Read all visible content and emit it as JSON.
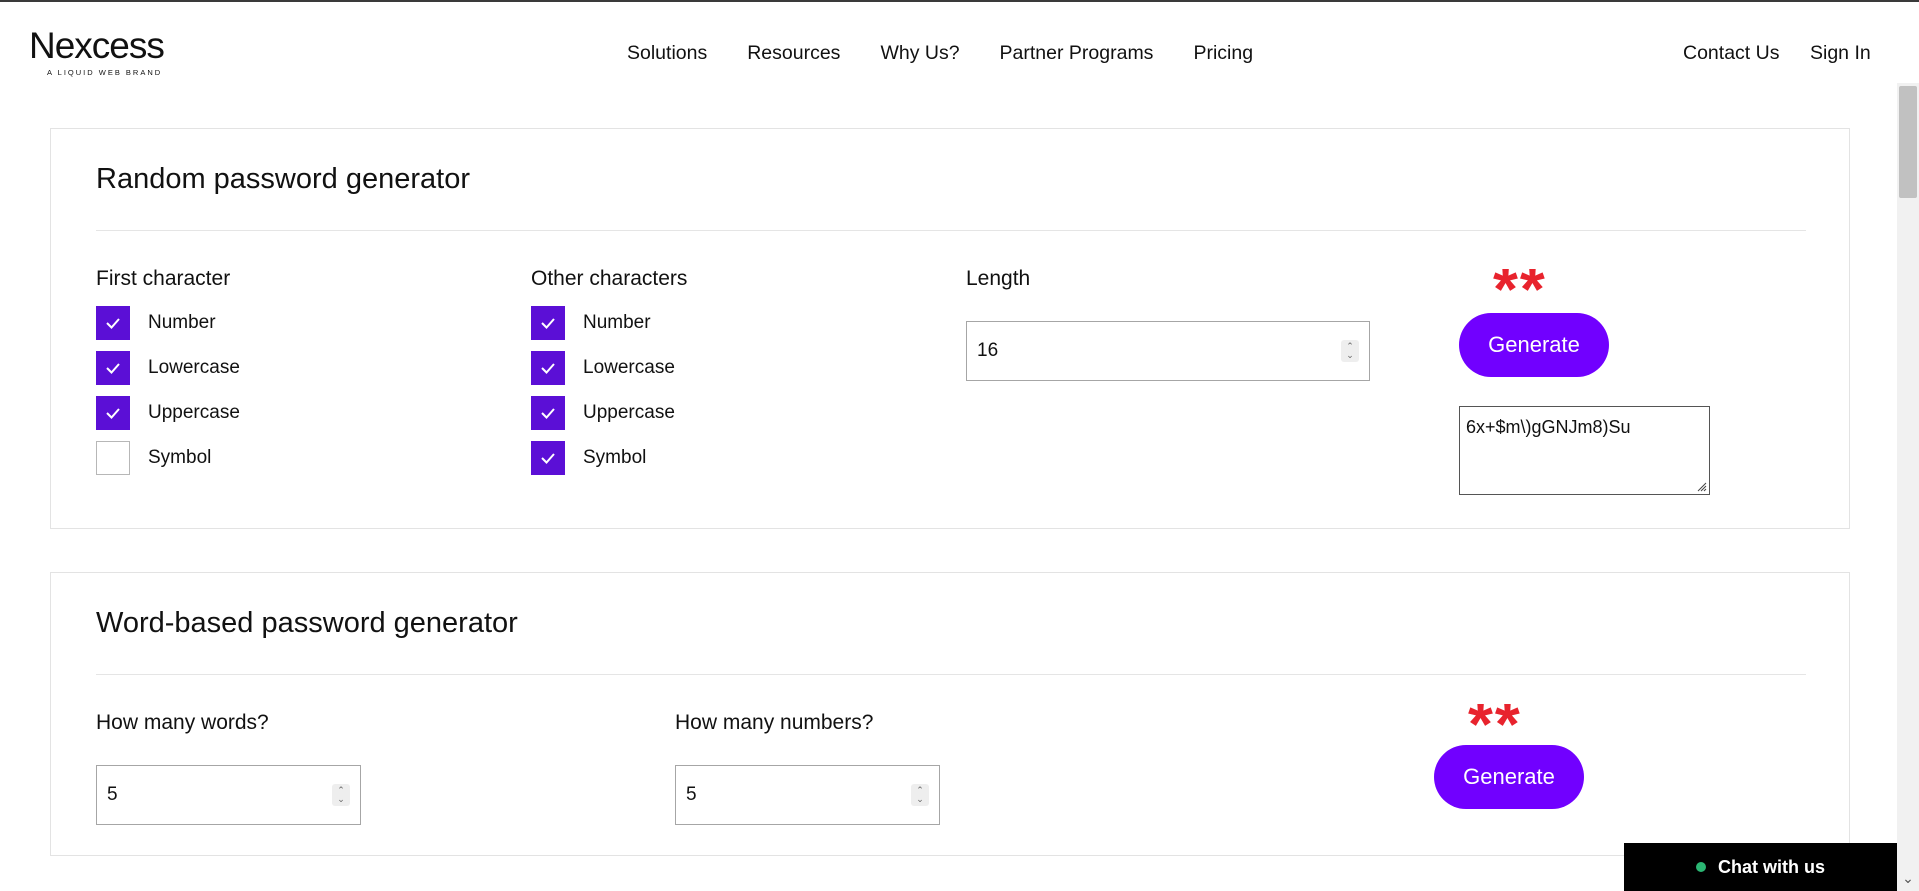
{
  "header": {
    "logo": "Nexcess",
    "logo_tagline": "A LIQUID WEB BRAND",
    "nav": [
      "Solutions",
      "Resources",
      "Why Us?",
      "Partner Programs",
      "Pricing"
    ],
    "contact": "Contact Us",
    "sign_in": "Sign In"
  },
  "random_generator": {
    "title": "Random password generator",
    "first_character": {
      "label": "First character",
      "options": [
        {
          "label": "Number",
          "checked": true
        },
        {
          "label": "Lowercase",
          "checked": true
        },
        {
          "label": "Uppercase",
          "checked": true
        },
        {
          "label": "Symbol",
          "checked": false
        }
      ]
    },
    "other_characters": {
      "label": "Other characters",
      "options": [
        {
          "label": "Number",
          "checked": true
        },
        {
          "label": "Lowercase",
          "checked": true
        },
        {
          "label": "Uppercase",
          "checked": true
        },
        {
          "label": "Symbol",
          "checked": true
        }
      ]
    },
    "length": {
      "label": "Length",
      "value": "16"
    },
    "asterisks": "**",
    "generate": "Generate",
    "output": "6x+$m\\)gGNJm8)Su"
  },
  "word_generator": {
    "title": "Word-based password generator",
    "words": {
      "label": "How many words?",
      "value": "5"
    },
    "numbers": {
      "label": "How many numbers?",
      "value": "5"
    },
    "asterisks": "**",
    "generate": "Generate"
  },
  "chat": {
    "label": "Chat with us"
  },
  "colors": {
    "accent": "#7100ff",
    "checkbox": "#5b0fd6",
    "asterisk": "#e8232d"
  }
}
